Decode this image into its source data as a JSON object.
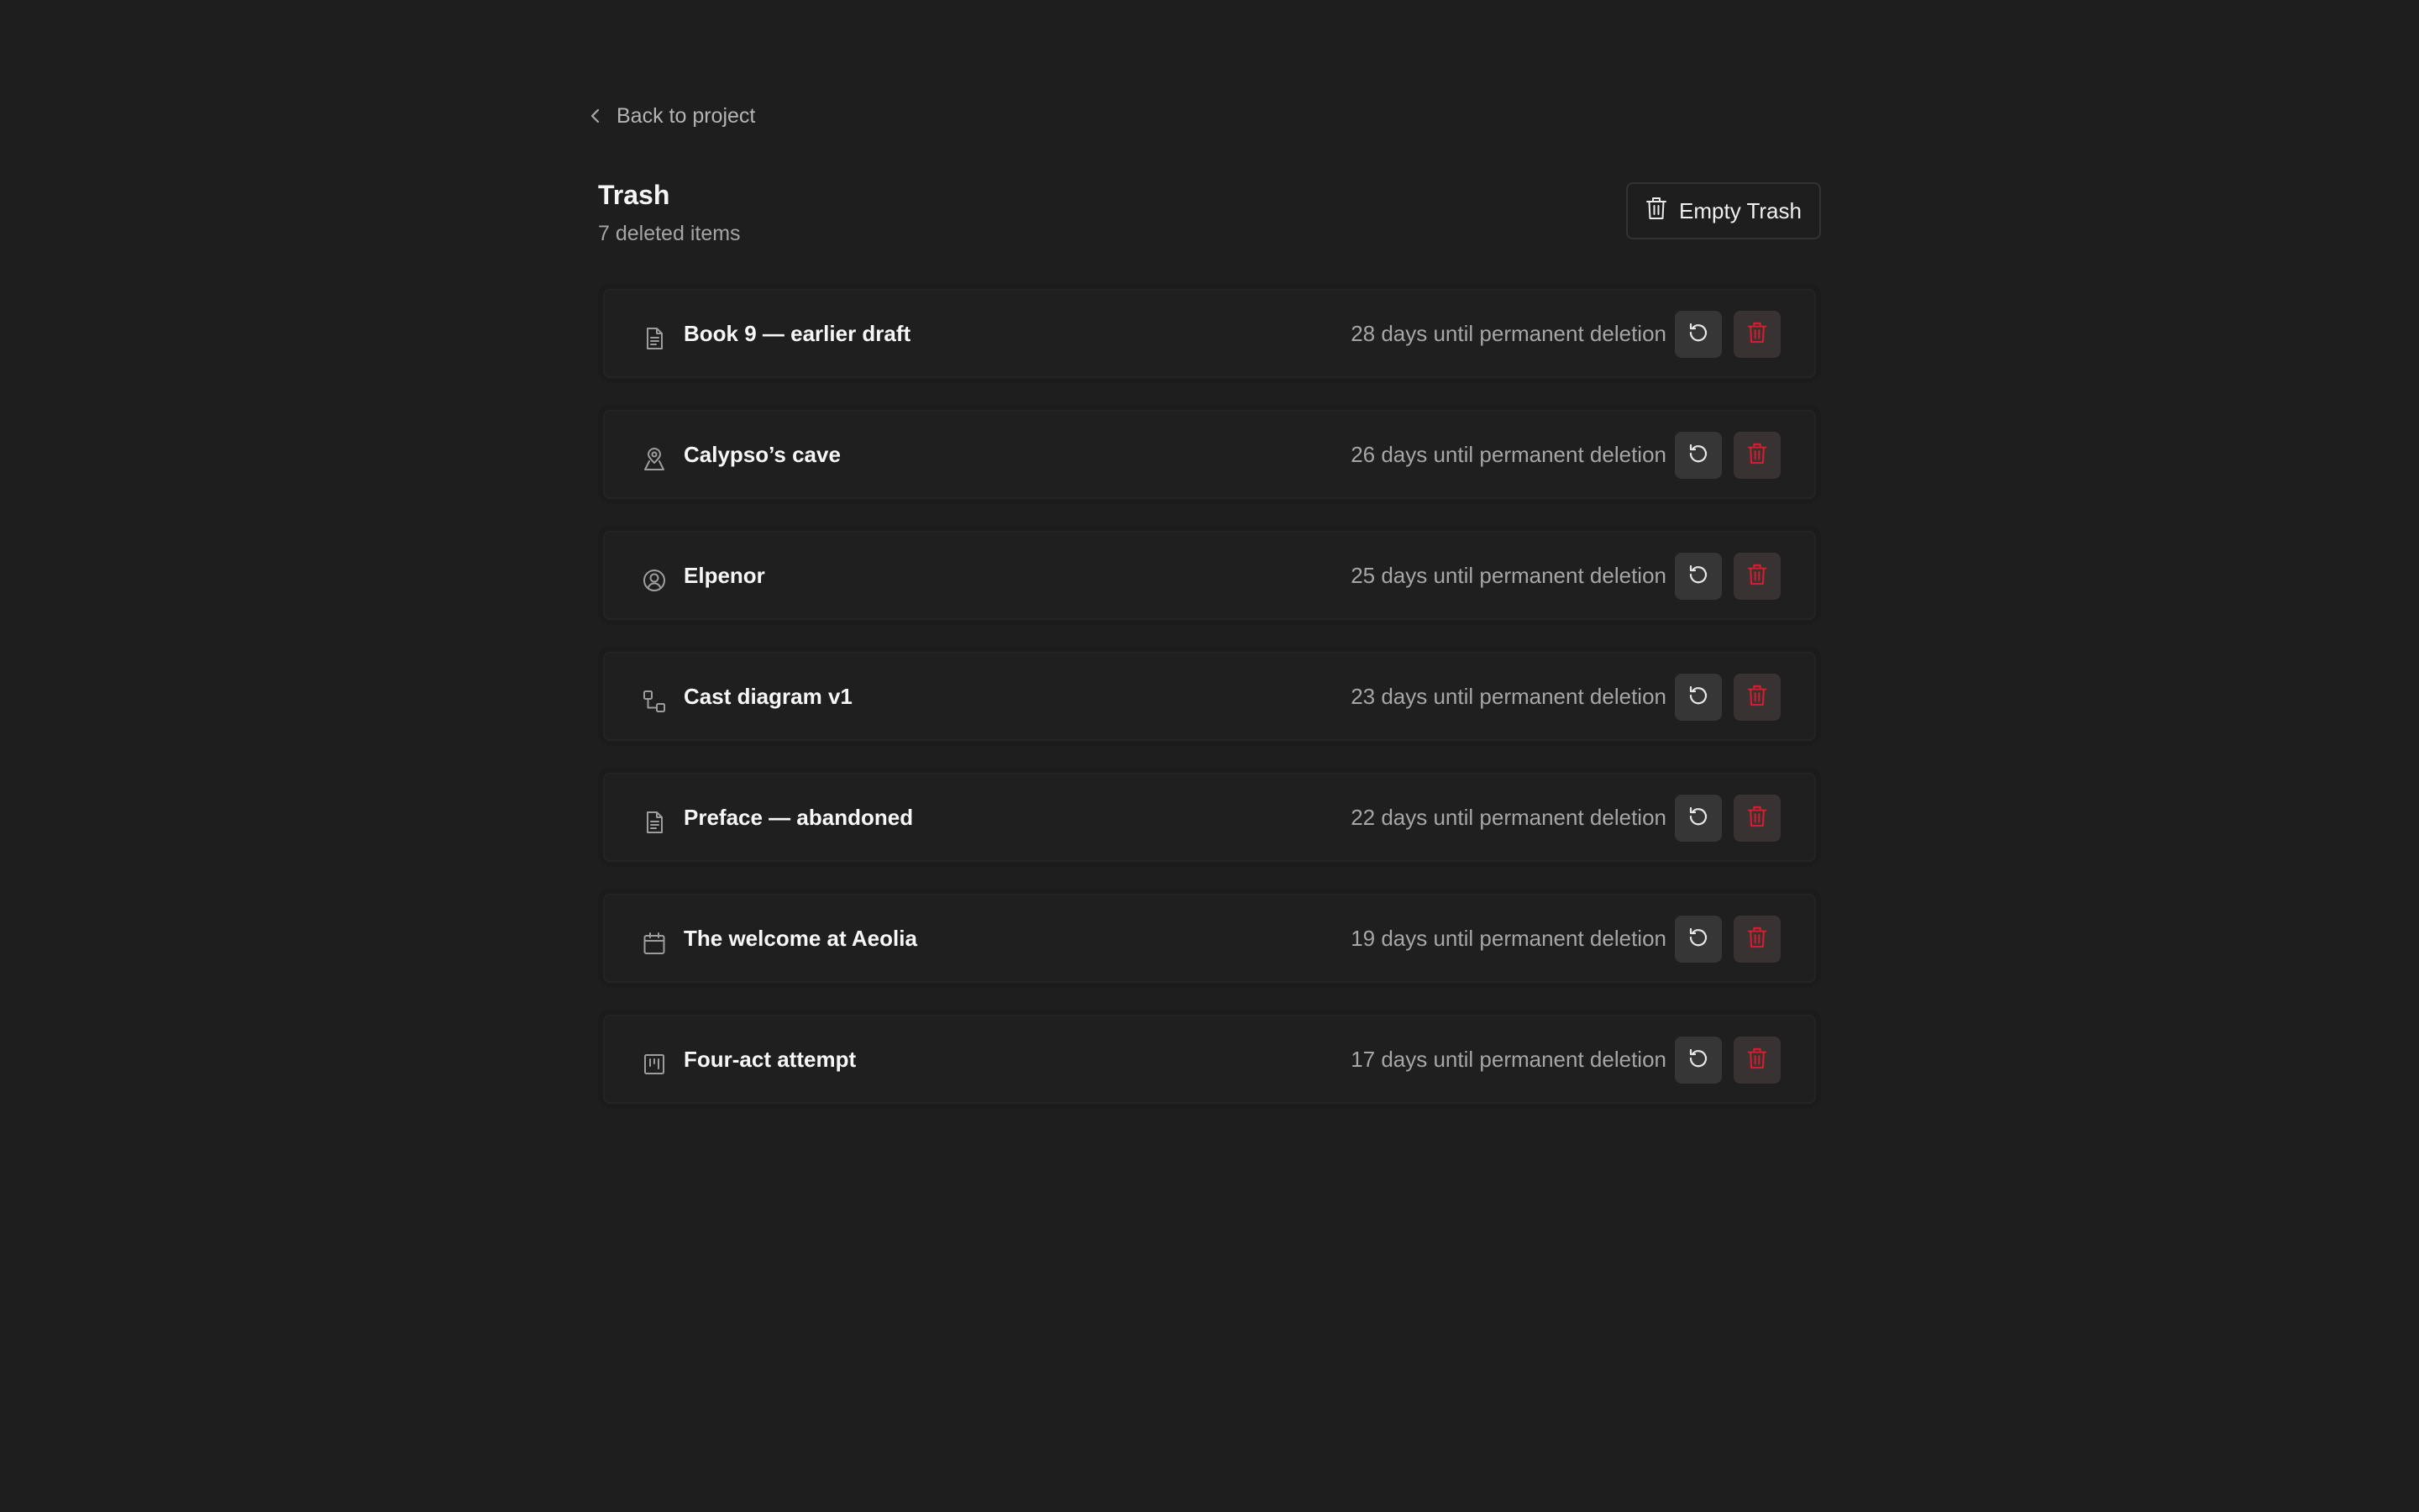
{
  "nav": {
    "back_label": "Back to project"
  },
  "header": {
    "title": "Trash",
    "subtitle": "7 deleted items",
    "empty_button_label": "Empty Trash"
  },
  "items": [
    {
      "icon": "document-icon",
      "name": "Book 9 — earlier draft",
      "days": "28 days until permanent deletion"
    },
    {
      "icon": "location-icon",
      "name": "Calypso’s cave",
      "days": "26 days until permanent deletion"
    },
    {
      "icon": "character-icon",
      "name": "Elpenor",
      "days": "25 days until permanent deletion"
    },
    {
      "icon": "diagram-icon",
      "name": "Cast diagram v1",
      "days": "23 days until permanent deletion"
    },
    {
      "icon": "document-icon",
      "name": "Preface — abandoned",
      "days": "22 days until permanent deletion"
    },
    {
      "icon": "calendar-icon",
      "name": "The welcome at Aeolia",
      "days": "19 days until permanent deletion"
    },
    {
      "icon": "board-icon",
      "name": "Four-act attempt",
      "days": "17 days until permanent deletion"
    }
  ],
  "colors": {
    "background": "#1e1e1e",
    "danger": "#d11f2f",
    "muted_text": "#a6a6a6"
  }
}
